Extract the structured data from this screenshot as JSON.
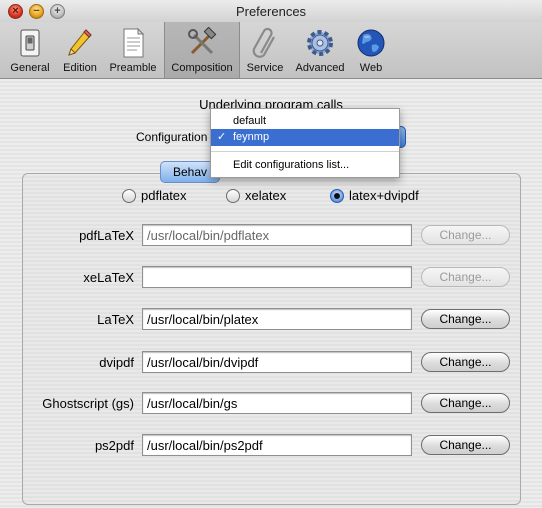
{
  "window": {
    "title": "Preferences"
  },
  "toolbar": {
    "items": [
      {
        "label": "General",
        "icon": "light-switch-icon"
      },
      {
        "label": "Edition",
        "icon": "pencil-icon"
      },
      {
        "label": "Preamble",
        "icon": "document-icon"
      },
      {
        "label": "Composition",
        "icon": "tools-icon",
        "selected": true
      },
      {
        "label": "Service",
        "icon": "paperclip-icon"
      },
      {
        "label": "Advanced",
        "icon": "gear-icon"
      },
      {
        "label": "Web",
        "icon": "globe-icon"
      }
    ]
  },
  "composition": {
    "section_title": "Underlying program calls",
    "configuration_label": "Configuration",
    "tab_label": "Behav",
    "menu": {
      "items": [
        {
          "label": "default"
        },
        {
          "label": "feynmp",
          "checked": true,
          "highlighted": true
        },
        {
          "label": "Edit configurations list..."
        }
      ],
      "check_glyph": "✓"
    },
    "engines": {
      "options": [
        "pdflatex",
        "xelatex",
        "latex+dvipdf"
      ],
      "selected": "latex+dvipdf"
    },
    "change_label": "Change...",
    "rows": [
      {
        "label": "pdfLaTeX",
        "value": "/usr/local/bin/pdflatex",
        "enabled": false
      },
      {
        "label": "xeLaTeX",
        "value": "",
        "enabled": false
      },
      {
        "label": "LaTeX",
        "value": "/usr/local/bin/platex",
        "enabled": true
      },
      {
        "label": "dvipdf",
        "value": "/usr/local/bin/dvipdf",
        "enabled": true
      },
      {
        "label": "Ghostscript (gs)",
        "value": "/usr/local/bin/gs",
        "enabled": true
      },
      {
        "label": "ps2pdf",
        "value": "/usr/local/bin/ps2pdf",
        "enabled": true
      }
    ]
  },
  "colors": {
    "highlight": "#3a6fd1",
    "popup_blue": "#3f7fd8"
  }
}
